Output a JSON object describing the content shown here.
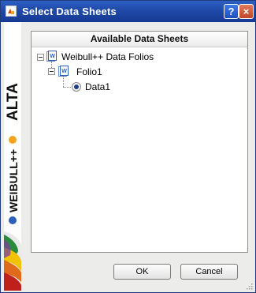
{
  "window": {
    "title": "Select Data Sheets",
    "title_icon": "app-icon",
    "help_glyph": "?",
    "close_glyph": "×"
  },
  "sidebar": {
    "brand_main": "WEIBULL++",
    "brand_secondary": "ALTA"
  },
  "panel": {
    "header": "Available Data Sheets",
    "tree": {
      "root": {
        "label": "Weibull++ Data Folios",
        "icon": "folio-icon",
        "expanded": true
      },
      "folio": {
        "label": "Folio1",
        "icon": "folio-icon",
        "expanded": true
      },
      "sheet": {
        "label": "Data1",
        "icon": "radio-icon",
        "selected": true
      }
    }
  },
  "buttons": {
    "ok": "OK",
    "cancel": "Cancel"
  },
  "colors": {
    "titlebar": "#1f49a8",
    "accent_orange": "#f4a51c",
    "brand_blue": "#2b5fb8"
  }
}
